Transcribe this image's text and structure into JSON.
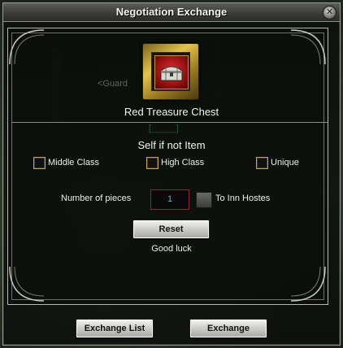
{
  "window": {
    "title": "Negotiation Exchange",
    "close_icon": "close-icon"
  },
  "item": {
    "name": "Red Treasure Chest",
    "icon": "treasure-chest-icon"
  },
  "background_text": {
    "guard": "<Guard",
    "faded_green": "[_____]"
  },
  "filter": {
    "title": "Self if not Item",
    "options": [
      {
        "label": "Middle Class",
        "checked": false
      },
      {
        "label": "High Class",
        "checked": false
      },
      {
        "label": "Unique",
        "checked": false
      }
    ]
  },
  "quantity": {
    "label": "Number of pieces",
    "value": "1"
  },
  "inn": {
    "label": "To Inn Hostes",
    "checked": false
  },
  "buttons": {
    "reset": "Reset",
    "exchange_list": "Exchange List",
    "exchange": "Exchange"
  },
  "message": "Good luck",
  "colors": {
    "accent_gold": "#c9a34a",
    "quantity_text": "#3fb8e8",
    "item_red": "#e23030"
  }
}
